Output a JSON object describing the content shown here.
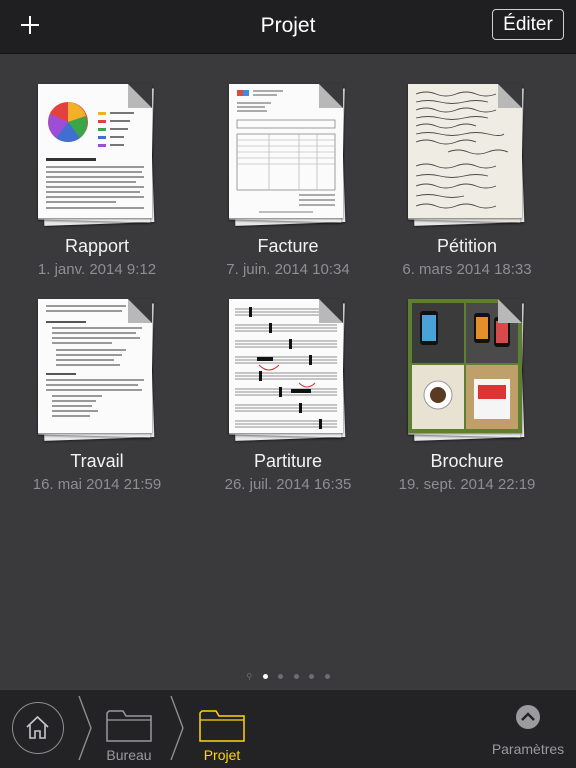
{
  "header": {
    "title": "Projet",
    "edit_label": "Éditer"
  },
  "documents": [
    {
      "name": "Rapport",
      "date": "1. janv. 2014 9:12"
    },
    {
      "name": "Facture",
      "date": "7. juin. 2014 10:34"
    },
    {
      "name": "Pétition",
      "date": "6. mars 2014 18:33"
    },
    {
      "name": "Travail",
      "date": "16. mai 2014 21:59"
    },
    {
      "name": "Partiture",
      "date": "26. juil. 2014 16:35"
    },
    {
      "name": "Brochure",
      "date": "19. sept. 2014 22:19"
    }
  ],
  "pagination": {
    "current": 1,
    "total": 5
  },
  "bottom": {
    "crumbs": [
      {
        "label": "Bureau"
      },
      {
        "label": "Projet"
      }
    ],
    "settings_label": "Paramètres"
  },
  "colors": {
    "accent": "#ffd60a",
    "background": "#3a3a3c",
    "bar": "#1f1f21"
  }
}
